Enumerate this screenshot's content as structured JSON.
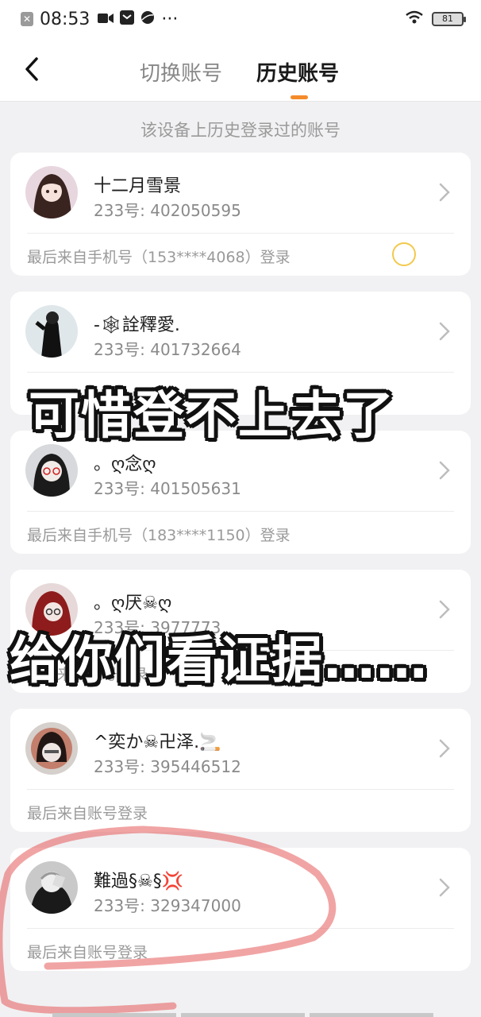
{
  "statusbar": {
    "time": "08:53",
    "dots": "···",
    "battery": "81"
  },
  "header": {
    "tabs": [
      {
        "label": "切换账号",
        "active": false
      },
      {
        "label": "历史账号",
        "active": true
      }
    ],
    "accent_color": "#f48b2a"
  },
  "subtitle": "该设备上历史登录过的账号",
  "accounts": [
    {
      "name": "十二月雪景",
      "uid": "233号: 402050595",
      "login_info": "最后来自手机号（153****4068）登录",
      "avatar": "avatar-girl"
    },
    {
      "name": "-🕸詮釋愛.",
      "uid": "233号: 401732664",
      "login_info": "",
      "avatar": "avatar-dark-figure"
    },
    {
      "name": "。ღ念ღ",
      "uid": "233号: 401505631",
      "login_info": "最后来自手机号（183****1150）登录",
      "avatar": "avatar-glasses"
    },
    {
      "name": "。ღ厌☠ღ",
      "uid": "233号: 3977773",
      "login_info": "最后来自账号登录",
      "avatar": "avatar-red-hair"
    },
    {
      "name": "^奕か☠卍泽.🚬",
      "uid": "233号: 395446512",
      "login_info": "最后来自账号登录",
      "avatar": "avatar-boy"
    },
    {
      "name": "難過§☠§💢",
      "uid": "233号: 329347000",
      "login_info": "最后来自账号登录",
      "avatar": "avatar-mono"
    }
  ],
  "overlay": {
    "line1": "可惜登不上去了",
    "line2": "给你们看证据……"
  }
}
